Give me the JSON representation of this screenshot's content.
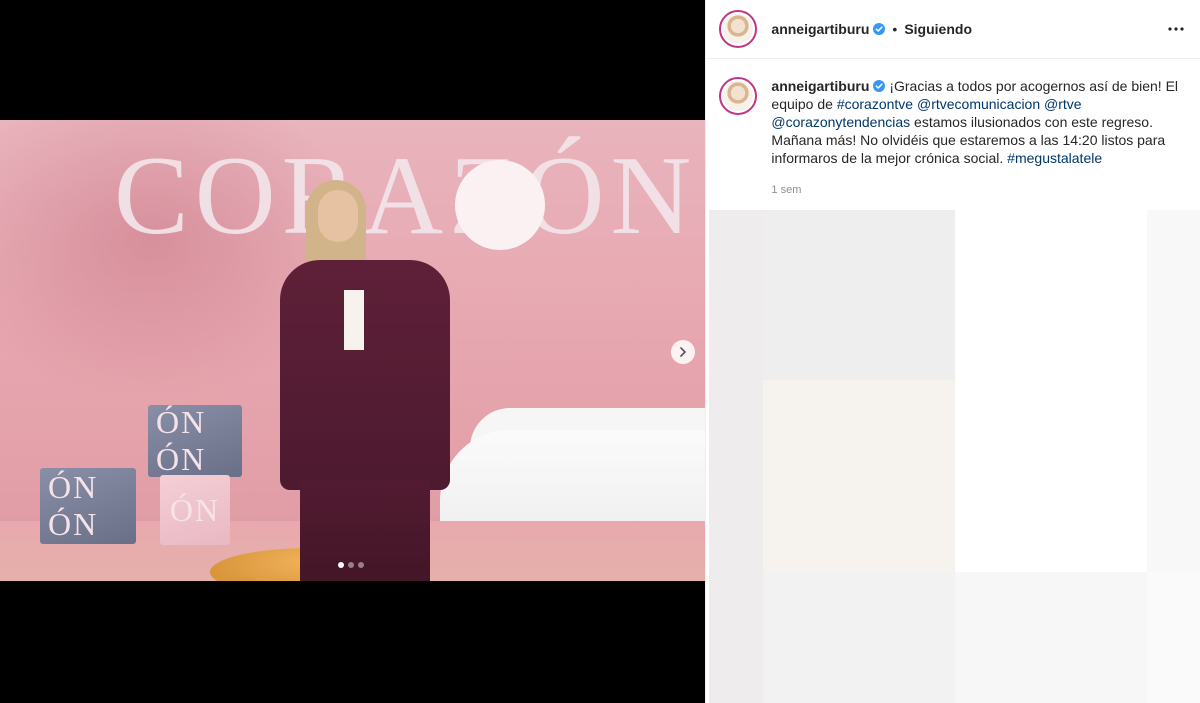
{
  "media": {
    "photo_sign_text": "CORAZÓN",
    "cube_marks": [
      "ÓN ÓN",
      "ÓN ÓN",
      "ÓN"
    ],
    "carousel_dots": 3,
    "active_dot": 0,
    "next_icon": "chevron-right-icon"
  },
  "header": {
    "username": "anneigartiburu",
    "verified_icon": "verified-badge-icon",
    "separator": "•",
    "follow_label": "Siguiendo",
    "more_icon": "more-horizontal-icon"
  },
  "caption": {
    "username": "anneigartiburu",
    "text_1": "¡Gracias a todos por acogernos así de bien! El equipo de ",
    "hashtag_1": "#corazontve",
    "mention_1": "@rtvecomunicacion",
    "mention_2": "@rtve",
    "mention_3": "@corazonytendencias",
    "text_2": " estamos ilusionados con este regreso. Mañana más! No olvidéis que estaremos a las 14:20 listos para informaros de la mejor crónica social. ",
    "hashtag_2": "#megustalatele",
    "timestamp": "1 sem"
  },
  "colors": {
    "link": "#00376b",
    "verified": "#3897f0",
    "story_ring": "#c13584"
  }
}
